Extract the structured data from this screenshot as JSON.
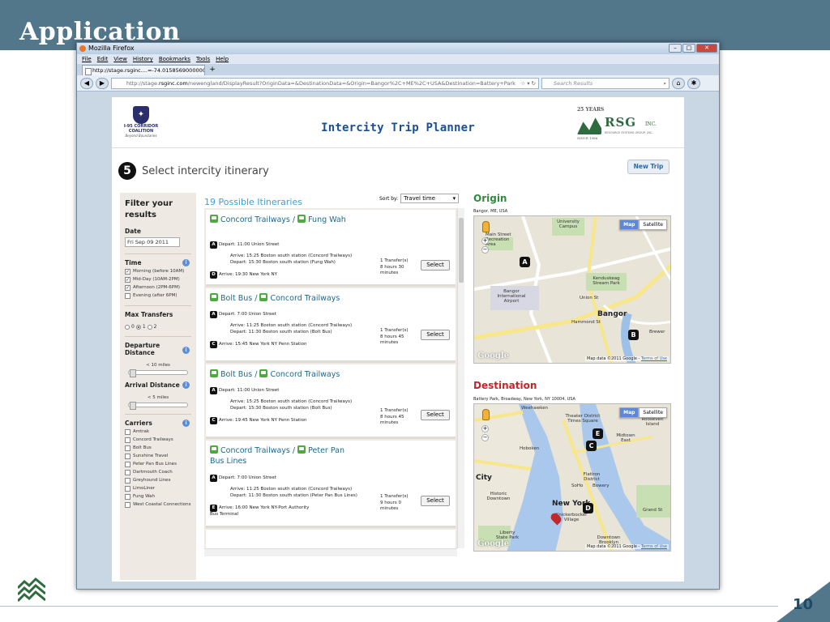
{
  "slide": {
    "title": "Application",
    "page_number": "10"
  },
  "browser": {
    "window_title": "Mozilla Firefox",
    "menu": [
      "File",
      "Edit",
      "View",
      "History",
      "Bookmarks",
      "Tools",
      "Help"
    ],
    "tab_label": "http://stage.rsginc....=-74.01585690000002",
    "url_prefix": "http://stage.",
    "url_domain": "rsginc.com",
    "url_rest": "/newengland/DisplayResult?OriginData=&DestinationData=&Origin=Bangor%2C+ME%2C+USA&Destination=Battery+Park",
    "search_placeholder": "Search Results"
  },
  "app": {
    "title": "Intercity Trip Planner",
    "coalition_logo_line1": "I-95 CORRIDOR",
    "coalition_logo_line2": "COALITION",
    "coalition_logo_tagline": "Beyond Boundaries",
    "rsg_years": "25 YEARS",
    "rsg_name": "RSG",
    "rsg_inc": "INC.",
    "rsg_sub": "RESOURCE SYSTEMS GROUP, INC.",
    "rsg_since": "SINCE 1986",
    "step_number": "5",
    "step_label": "Select intercity itinerary",
    "new_trip_label": "New Trip"
  },
  "filter": {
    "title": "Filter your results",
    "date_label": "Date",
    "date_value": "Fri Sep 09 2011",
    "time_label": "Time",
    "time_options": [
      {
        "label": "Morning (before 10AM)",
        "checked": true
      },
      {
        "label": "Mid-Day (10AM-2PM)",
        "checked": true
      },
      {
        "label": "Afternoon (2PM-6PM)",
        "checked": true
      },
      {
        "label": "Evening (after 6PM)",
        "checked": false
      }
    ],
    "max_transfers_label": "Max Transfers",
    "transfer_options": [
      "0",
      "1",
      "2"
    ],
    "transfer_selected": "1",
    "departure_distance_label": "Departure Distance",
    "departure_distance_value": "< 10 miles",
    "arrival_distance_label": "Arrival Distance",
    "arrival_distance_value": "< 5 miles",
    "carriers_label": "Carriers",
    "carriers": [
      "Amtrak",
      "Concord Trailways",
      "Bolt Bus",
      "Sunshine Travel",
      "Peter Pan Bus Lines",
      "Dartmouth Coach",
      "Greyhound Lines",
      "LimoLiner",
      "Fung Wah",
      "West Coastal Connections"
    ]
  },
  "itineraries": {
    "count_label": "19 Possible Itineraries",
    "sort_label": "Sort by:",
    "sort_value": "Travel time",
    "select_label": "Select",
    "items": [
      {
        "carriers": "Concord Trailways / ",
        "carriers2": "Fung Wah",
        "depart": "Depart: 11:00 Union Street",
        "arrive1": "Arrive: 15:25 Boston south station (Concord Trailways)",
        "depart2": "Depart: 15:30 Boston south station (Fung Wah)",
        "final_marker": "D",
        "final": "Arrive: 19:30 New York NY",
        "final2": "",
        "transfers": "1 Transfer(s)",
        "duration": "8 hours 30 minutes"
      },
      {
        "carriers": "Bolt Bus / ",
        "carriers2": "Concord Trailways",
        "depart": "Depart: 7:00 Union Street",
        "arrive1": "Arrive: 11:25 Boston south station (Concord Trailways)",
        "depart2": "Depart: 11:30 Boston south station (Bolt Bus)",
        "final_marker": "C",
        "final": "Arrive: 15:45 New York NY Penn Station",
        "final2": "",
        "transfers": "1 Transfer(s)",
        "duration": "8 hours 45 minutes"
      },
      {
        "carriers": "Bolt Bus / ",
        "carriers2": "Concord Trailways",
        "depart": "Depart: 11:00 Union Street",
        "arrive1": "Arrive: 15:25 Boston south station (Concord Trailways)",
        "depart2": "Depart: 15:30 Boston south station (Bolt Bus)",
        "final_marker": "C",
        "final": "Arrive: 19:45 New York NY Penn Station",
        "final2": "",
        "transfers": "1 Transfer(s)",
        "duration": "8 hours 45 minutes"
      },
      {
        "carriers": "Concord Trailways / ",
        "carriers2": "Peter Pan Bus Lines",
        "depart": "Depart: 7:00 Union Street",
        "arrive1": "Arrive: 11:25 Boston south station (Concord Trailways)",
        "depart2": "Depart: 11:30 Boston south station (Peter Pan Bus Lines)",
        "final_marker": "E",
        "final": "Arrive: 16:00 New York NY-Port Authority",
        "final2": "Bus Terminal",
        "transfers": "1 Transfer(s)",
        "duration": "9 hours 0 minutes"
      }
    ]
  },
  "origin": {
    "title": "Origin",
    "address": "Bangor, ME, USA",
    "map_btn": "Map",
    "sat_btn": "Satellite",
    "footer": "Map data ©2011 Google - ",
    "footer_link": "Terms of Use",
    "labels": [
      "University Campus",
      "Main Street Recreation Area",
      "Bangor International Airport",
      "Kenduskeag Stream Park",
      "Bangor",
      "Brewer",
      "Union St",
      "Hammond St"
    ],
    "markers": [
      "A",
      "B"
    ]
  },
  "destination": {
    "title": "Destination",
    "address": "Battery Park, Broadway, New York, NY 10004, USA",
    "map_btn": "Map",
    "sat_btn": "Satellite",
    "footer": "Map data ©2011 Google - ",
    "footer_link": "Terms of Use",
    "labels": [
      "Weehawken",
      "Theater District Times Square",
      "Roosevelt Island",
      "Midtown East",
      "Hoboken",
      "New York",
      "Flatiron District",
      "SoHo",
      "Bowery",
      "Historic Downtown",
      "Knickerbocker Village",
      "Liberty State Park",
      "Downtown Brooklyn",
      "City",
      "Grand St"
    ],
    "markers": [
      "E",
      "C",
      "D"
    ]
  },
  "colors": {
    "slide_band": "#52768a",
    "title_blue": "#1b4f94",
    "section_green": "#2e8b3a",
    "destination_red": "#c0282d",
    "link_blue": "#3aa0d8"
  }
}
